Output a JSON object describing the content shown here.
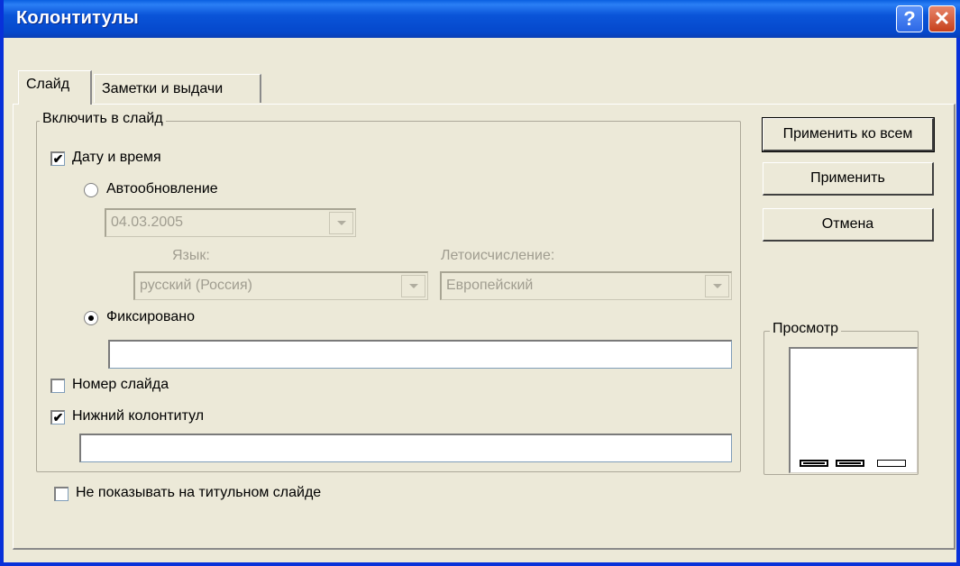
{
  "window": {
    "title": "Колонтитулы",
    "help_label": "?",
    "close_label": "✕"
  },
  "tabs": [
    {
      "label": "Слайд",
      "active": true
    },
    {
      "label": "Заметки и выдачи",
      "active": false
    }
  ],
  "include_group": {
    "legend": "Включить в слайд",
    "date_time": {
      "label": "Дату и время",
      "checked": true
    },
    "auto_update": {
      "label": "Автообновление",
      "selected": false
    },
    "date_select": {
      "value": "04.03.2005",
      "enabled": false
    },
    "language": {
      "label": "Язык:",
      "value": "русский (Россия)",
      "enabled": false
    },
    "calendar": {
      "label": "Летоисчисление:",
      "value": "Европейский",
      "enabled": false
    },
    "fixed": {
      "label": "Фиксировано",
      "selected": true,
      "value": ""
    },
    "slide_number": {
      "label": "Номер слайда",
      "checked": false
    },
    "footer": {
      "label": "Нижний колонтитул",
      "checked": true,
      "value": ""
    }
  },
  "dont_show_title": {
    "label": "Не показывать на титульном слайде",
    "checked": false
  },
  "buttons": {
    "apply_all": "Применить ко всем",
    "apply": "Применить",
    "cancel": "Отмена"
  },
  "preview": {
    "legend": "Просмотр"
  },
  "icons": {
    "checkmark": "✔"
  }
}
